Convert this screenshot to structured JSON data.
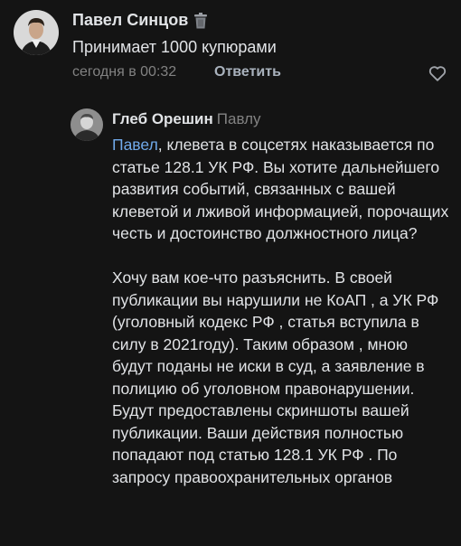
{
  "comment": {
    "author": "Павел Синцов",
    "text": "Принимает 1000 купюрами",
    "time": "сегодня в 00:32",
    "reply_label": "Ответить"
  },
  "reply": {
    "author": "Глеб Орешин",
    "to": "Павлу",
    "mention": "Павел",
    "paragraph1_rest": ", клевета в соцсетях наказывается по статье 128.1 УК РФ. Вы хотите дальнейшего развития событий, связанных с вашей клеветой и лживой информацией, порочащих честь и достоинство должностного лица?",
    "paragraph2": "Хочу вам кое-что разъяснить. В своей публикации вы нарушили не КоАП , а УК РФ (уголовный кодекс РФ , статья вступила в силу в 2021году). Таким образом , мною будут поданы не иски в суд, а заявление в полицию об уголовном правонарушении. Будут предоставлены скриншоты вашей публикации. Ваши действия полностью попадают под статью 128.1 УК РФ . По запросу правоохранительных органов"
  },
  "icons": [
    "avatar",
    "trash-icon",
    "heart-icon"
  ],
  "colors": {
    "background": "#141414",
    "text": "#e1e3e6",
    "muted": "#828282",
    "link": "#71aaeb"
  }
}
